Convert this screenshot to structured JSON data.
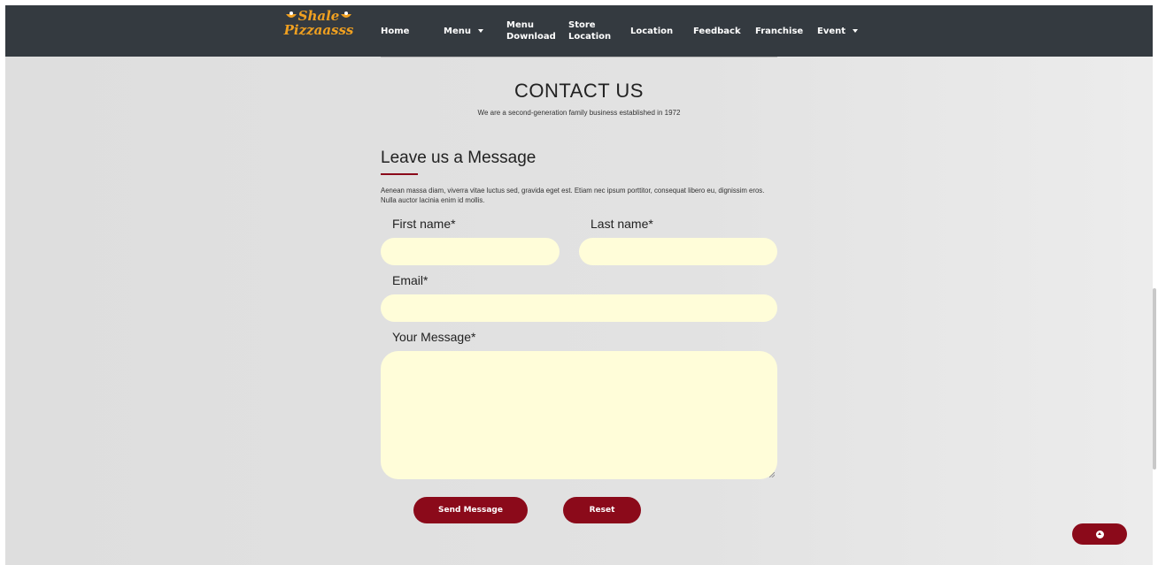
{
  "brand": {
    "logo_line1": "Shale",
    "logo_line2": "Pizzaasss",
    "accent": "#f0a020"
  },
  "nav": {
    "items": [
      {
        "label": "Home"
      },
      {
        "label": "Menu",
        "dropdown": true
      },
      {
        "label_line1": "Menu",
        "label_line2": "Download"
      },
      {
        "label_line1": "Store",
        "label_line2": "Location"
      },
      {
        "label": "Location"
      },
      {
        "label": "Feedback"
      },
      {
        "label": "Franchise"
      },
      {
        "label": "Event",
        "dropdown": true
      }
    ],
    "background": "#343a40"
  },
  "contact": {
    "title": "CONTACT US",
    "subtitle": "We are a second-generation family business established in 1972"
  },
  "form": {
    "heading": "Leave us a Message",
    "description": "Aenean massa diam, viverra vitae luctus sed, gravida eget est. Etiam nec ipsum porttitor, consequat libero eu, dignissim eros. Nulla auctor lacinia enim id mollis.",
    "first_name_label": "First name*",
    "last_name_label": "Last name*",
    "email_label": "Email*",
    "message_label": "Your Message*",
    "first_name_value": "",
    "last_name_value": "",
    "email_value": "",
    "message_value": "",
    "field_color": "#fffdd9",
    "send_label": "Send Message",
    "reset_label": "Reset",
    "button_color": "#8b0a1a"
  },
  "scroll_top": {
    "icon": "arrow-up-circle-icon"
  }
}
